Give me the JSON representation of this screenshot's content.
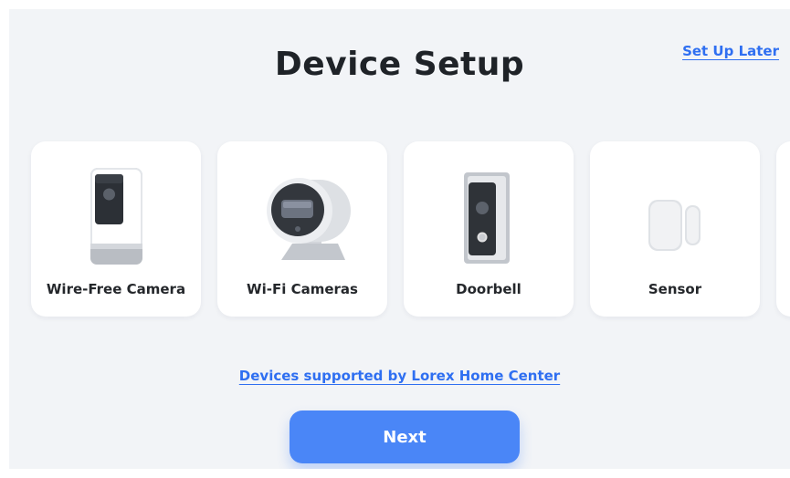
{
  "header": {
    "title": "Device Setup",
    "set_up_later": "Set Up Later"
  },
  "devices": [
    {
      "label": "Wire-Free Camera",
      "icon": "wire-free-camera-icon"
    },
    {
      "label": "Wi-Fi Cameras",
      "icon": "wifi-camera-icon"
    },
    {
      "label": "Doorbell",
      "icon": "doorbell-icon"
    },
    {
      "label": "Sensor",
      "icon": "sensor-icon"
    }
  ],
  "footer": {
    "supported_link": "Devices supported by Lorex Home Center",
    "next_label": "Next"
  },
  "colors": {
    "accent": "#4a86f7",
    "link": "#2f6ff1",
    "background": "#f2f4f7"
  }
}
